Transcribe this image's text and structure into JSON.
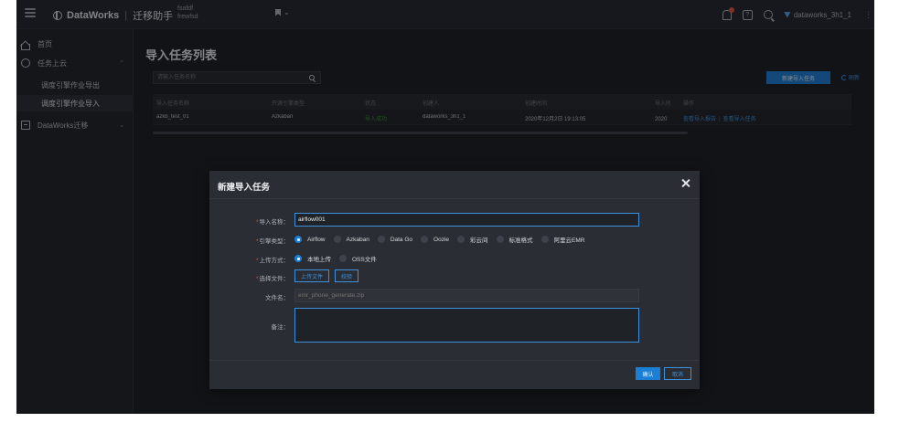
{
  "topbar": {
    "app_name": "DataWorks",
    "separator": "|",
    "module": "迁移助手",
    "project_line1": "fsafdf",
    "project_line2": "frewfsd",
    "flag_caret": "⌄",
    "user": "dataworks_3h1_1",
    "help_glyph": "?",
    "kebab": "⋮"
  },
  "sidebar": {
    "items": [
      {
        "label": "首页",
        "icon": "home-icon"
      },
      {
        "label": "任务上云",
        "icon": "cloud-upload-icon",
        "chevron": "⌃"
      },
      {
        "label": "调度引擎作业导出"
      },
      {
        "label": "调度引擎作业导入"
      },
      {
        "label": "DataWorks迁移",
        "icon": "migrate-icon",
        "chevron": "⌄"
      }
    ]
  },
  "main": {
    "title": "导入任务列表",
    "search_placeholder": "请输入任务名称",
    "new_task_button": "新建导入任务",
    "refresh_button": "刷新",
    "table": {
      "headers": [
        "导入任务名称",
        "开源引擎类型",
        "状态",
        "创建人",
        "创建时间",
        "导入时",
        "操作"
      ],
      "rows": [
        {
          "name": "azkb_test_01",
          "engine": "Azkaban",
          "status": "导入成功",
          "creator": "dataworks_3h1_1",
          "created": "2020年12月2日 19:13:05",
          "imported": "2020年",
          "action_report": "查看导入报告",
          "action_sep": "|",
          "action_task": "查看导入任务"
        }
      ]
    }
  },
  "modal": {
    "title": "新建导入任务",
    "fields": {
      "name_label": "导入名称：",
      "name_value": "airflow001",
      "engine_label": "引擎类型：",
      "engine_options": [
        "Airflow",
        "Azkaban",
        "Data Go",
        "Oozie",
        "彩云间",
        "标准格式",
        "阿里云EMR"
      ],
      "engine_selected": "Airflow",
      "upload_label": "上传方式：",
      "upload_options": [
        "本地上传",
        "OSS文件"
      ],
      "upload_selected": "本地上传",
      "file_label": "选择文件：",
      "upload_button": "上传文件",
      "verify_button": "校验",
      "filename_label": "文件名：",
      "filename_placeholder": "emr_phone_generate.zip",
      "remark_label": "备注：",
      "required_mark": "*"
    },
    "confirm_button": "确认",
    "cancel_button": "取消"
  },
  "colors": {
    "accent": "#1b7fd6",
    "link": "#3d92e0",
    "success": "#3b8f3b",
    "required": "#e0573a",
    "background": "#1a1c21"
  }
}
